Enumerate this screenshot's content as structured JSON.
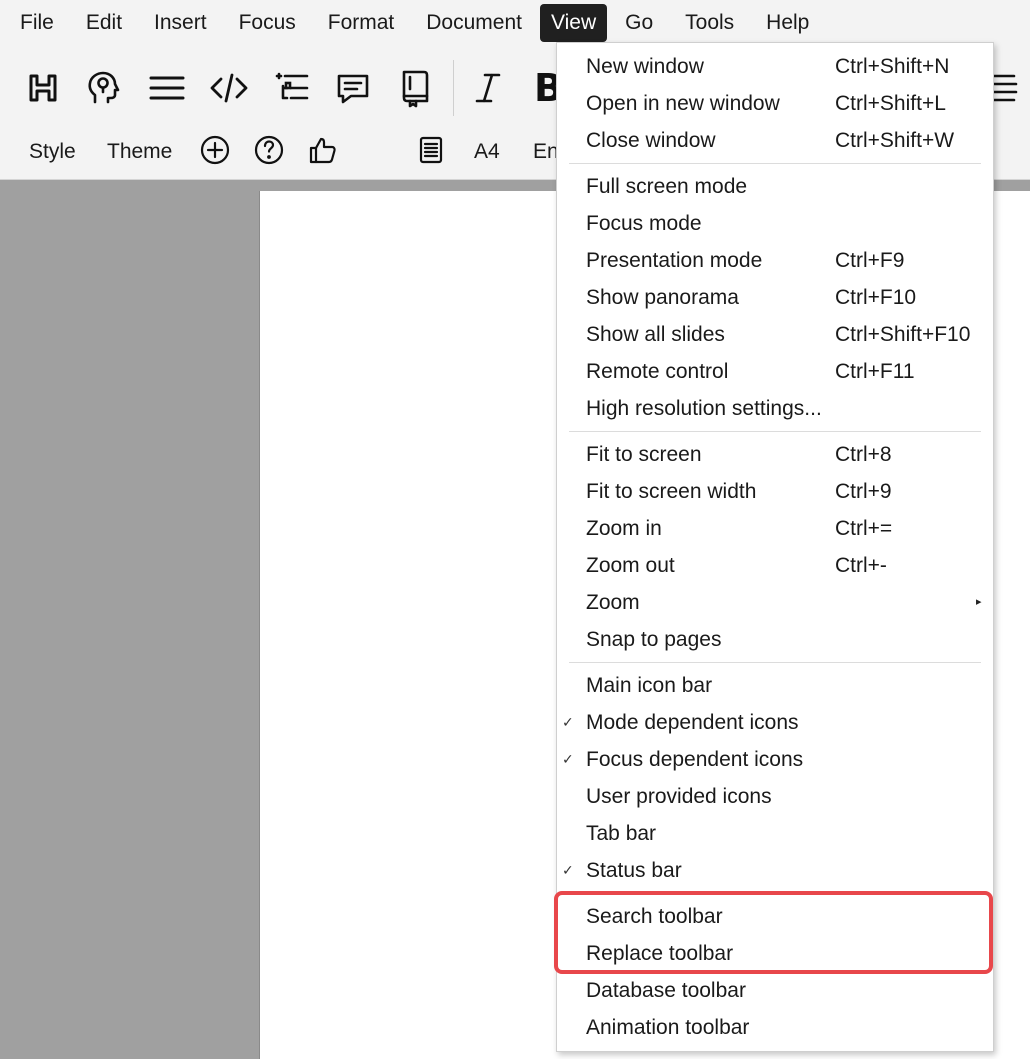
{
  "menubar": {
    "items": [
      "File",
      "Edit",
      "Insert",
      "Focus",
      "Format",
      "Document",
      "View",
      "Go",
      "Tools",
      "Help"
    ],
    "active": "View"
  },
  "toolbar": {
    "text_row": {
      "style": "Style",
      "theme": "Theme",
      "paper": "A4",
      "language_partial": "En"
    },
    "bold_partial": "B"
  },
  "view_menu": {
    "new_window": {
      "label": "New window",
      "shortcut": "Ctrl+Shift+N"
    },
    "open_new_window": {
      "label": "Open in new window",
      "shortcut": "Ctrl+Shift+L"
    },
    "close_window": {
      "label": "Close window",
      "shortcut": "Ctrl+Shift+W"
    },
    "full_screen": {
      "label": "Full screen mode"
    },
    "focus_mode": {
      "label": "Focus mode"
    },
    "presentation_mode": {
      "label": "Presentation mode",
      "shortcut": "Ctrl+F9"
    },
    "show_panorama": {
      "label": "Show panorama",
      "shortcut": "Ctrl+F10"
    },
    "show_all_slides": {
      "label": "Show all slides",
      "shortcut": "Ctrl+Shift+F10"
    },
    "remote_control": {
      "label": "Remote control",
      "shortcut": "Ctrl+F11"
    },
    "high_res": {
      "label": "High resolution settings..."
    },
    "fit_screen": {
      "label": "Fit to screen",
      "shortcut": "Ctrl+8"
    },
    "fit_width": {
      "label": "Fit to screen width",
      "shortcut": "Ctrl+9"
    },
    "zoom_in": {
      "label": "Zoom in",
      "shortcut": "Ctrl+="
    },
    "zoom_out": {
      "label": "Zoom out",
      "shortcut": "Ctrl+-"
    },
    "zoom": {
      "label": "Zoom"
    },
    "snap_pages": {
      "label": "Snap to pages"
    },
    "main_icon_bar": {
      "label": "Main icon bar",
      "checked": false
    },
    "mode_icons": {
      "label": "Mode dependent icons",
      "checked": true
    },
    "focus_icons": {
      "label": "Focus dependent icons",
      "checked": true
    },
    "user_icons": {
      "label": "User provided icons",
      "checked": false
    },
    "tab_bar": {
      "label": "Tab bar",
      "checked": false
    },
    "status_bar": {
      "label": "Status bar",
      "checked": true
    },
    "search_toolbar": {
      "label": "Search toolbar",
      "checked": false
    },
    "replace_toolbar": {
      "label": "Replace toolbar",
      "checked": false
    },
    "database_toolbar": {
      "label": "Database toolbar",
      "checked": false
    },
    "animation_toolbar": {
      "label": "Animation toolbar",
      "checked": false
    },
    "check_glyph": "✓",
    "submenu_glyph": "▸"
  },
  "colors": {
    "highlight": "#e8474b",
    "menu_active_bg": "#202020",
    "workspace": "#a0a0a0"
  },
  "icons": [
    "heading-icon",
    "mind-icon",
    "paragraph-icon",
    "code-icon",
    "outline-icon",
    "comment-icon",
    "notebook-icon",
    "italic-icon",
    "bold-icon",
    "stack-icon",
    "plus-circle-icon",
    "help-circle-icon",
    "thumbs-up-icon",
    "document-icon"
  ]
}
